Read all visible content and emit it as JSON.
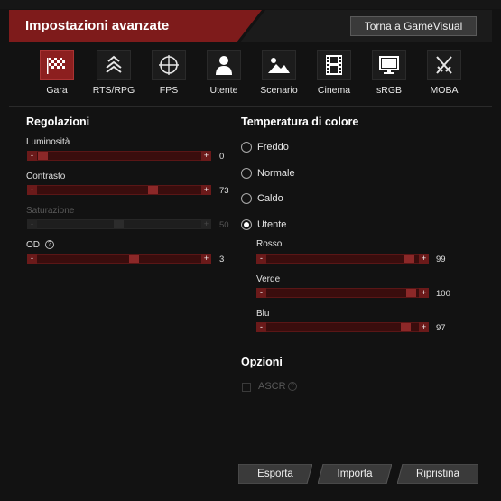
{
  "header": {
    "title": "Impostazioni avanzate",
    "back_label": "Torna a GameVisual"
  },
  "modes": [
    {
      "label": "Gara",
      "icon": "racing-flag-icon",
      "active": true
    },
    {
      "label": "RTS/RPG",
      "icon": "rank-chevron-icon",
      "active": false
    },
    {
      "label": "FPS",
      "icon": "crosshair-icon",
      "active": false
    },
    {
      "label": "Utente",
      "icon": "user-icon",
      "active": false
    },
    {
      "label": "Scenario",
      "icon": "landscape-icon",
      "active": false
    },
    {
      "label": "Cinema",
      "icon": "film-icon",
      "active": false
    },
    {
      "label": "sRGB",
      "icon": "monitor-icon",
      "active": false
    },
    {
      "label": "MOBA",
      "icon": "crossed-swords-icon",
      "active": false
    }
  ],
  "regolazioni": {
    "title": "Regolazioni",
    "brightness": {
      "label": "Luminosità",
      "value": "0",
      "minus": "-",
      "plus": "+"
    },
    "contrast": {
      "label": "Contrasto",
      "value": "73",
      "minus": "-",
      "plus": "+"
    },
    "saturation": {
      "label": "Saturazione",
      "value": "50",
      "minus": "-",
      "plus": "+"
    },
    "od": {
      "label": "OD",
      "value": "3",
      "minus": "-",
      "plus": "+",
      "help": "?"
    }
  },
  "temperatura": {
    "title": "Temperatura di colore",
    "options": [
      "Freddo",
      "Normale",
      "Caldo",
      "Utente"
    ],
    "selected": "Utente",
    "red": {
      "label": "Rosso",
      "value": "99",
      "minus": "-",
      "plus": "+"
    },
    "green": {
      "label": "Verde",
      "value": "100",
      "minus": "-",
      "plus": "+"
    },
    "blue": {
      "label": "Blu",
      "value": "97",
      "minus": "-",
      "plus": "+"
    }
  },
  "opzioni": {
    "title": "Opzioni",
    "ascr_label": "ASCR",
    "help": "?"
  },
  "footer": {
    "export_label": "Esporta",
    "import_label": "Importa",
    "reset_label": "Ripristina"
  },
  "colors": {
    "accent": "#8c1f1f",
    "track": "#3a0d0d",
    "background": "#121212"
  }
}
